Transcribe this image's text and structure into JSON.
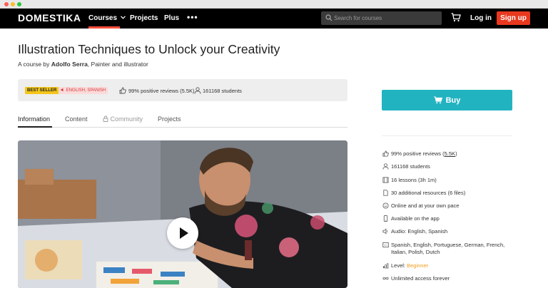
{
  "nav": {
    "logo": "DOMESTIKA",
    "courses_label": "Courses",
    "projects_label": "Projects",
    "plus_label": "Plus",
    "more_label": "•••",
    "search_placeholder": "Search for courses",
    "login_label": "Log in",
    "signup_label": "Sign up"
  },
  "course": {
    "title": "Illustration Techniques to Unlock your Creativity",
    "byline_prefix": "A course by",
    "author": "Adolfo Serra",
    "author_role": ", Painter and illustrator"
  },
  "strip": {
    "bestseller": "BEST SELLER",
    "languages": "ENGLISH, SPANISH",
    "reviews": "99% positive reviews (5.5K)",
    "students": "161168 students"
  },
  "tabs": [
    {
      "label": "Information"
    },
    {
      "label": "Content"
    },
    {
      "label": "Community"
    },
    {
      "label": "Projects"
    }
  ],
  "sidebar": {
    "buy_label": "Buy",
    "features": {
      "reviews_prefix": "99% positive reviews (",
      "reviews_count": "5.5K",
      "reviews_suffix": ")",
      "students": "161168 students",
      "lessons": "16 lessons (3h 1m)",
      "resources": "30 additional resources (6 files)",
      "pace": "Online and at your own pace",
      "app": "Available on the app",
      "audio": "Audio: English, Spanish",
      "subtitles_line1": "Spanish, English, Portuguese, German, French,",
      "subtitles_line2": "Italian, Polish, Dutch",
      "level_prefix": "Level: ",
      "level_value": "Beginner",
      "access": "Unlimited access forever"
    }
  },
  "colors": {
    "accent_red": "#e8381e",
    "buy_teal": "#22b3c1",
    "bestseller_yellow": "#f4c61b",
    "level_orange": "#f29d1a"
  }
}
